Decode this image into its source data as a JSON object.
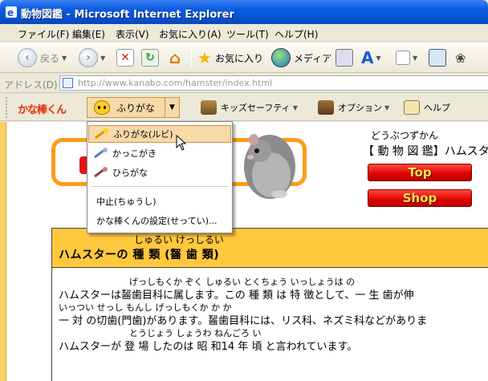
{
  "window": {
    "title": "動物図鑑 - Microsoft Internet Explorer"
  },
  "menubar": {
    "items": [
      {
        "label": "ファイル(F)"
      },
      {
        "label": "編集(E)"
      },
      {
        "label": "表示(V)"
      },
      {
        "label": "お気に入り(A)"
      },
      {
        "label": "ツール(T)"
      },
      {
        "label": "ヘルプ(H)"
      }
    ]
  },
  "toolbar": {
    "back_label": "戻る",
    "favorites_label": "お気に入り",
    "media_label": "メディア"
  },
  "address": {
    "label": "アドレス(D)",
    "url": "http://www.kanabo.com/hamster/index.html"
  },
  "kanabo": {
    "logo": "かな棒くん",
    "furigana_label": "ふりがな",
    "kids_safety_label": "キッズセーフティ",
    "option_label": "オプション",
    "help_label": "ヘルプ"
  },
  "dropdown": {
    "items": [
      {
        "label": "ふりがな(ルビ)"
      },
      {
        "label": "かっこがき"
      },
      {
        "label": "ひらがな"
      }
    ],
    "stop_label": "中止(ちゅうし)",
    "settings_label": "かな棒くんの設定(せってい)..."
  },
  "page": {
    "ruby_title": "どうぶつずかん",
    "db_title": "【 動 物 図 鑑】ハムスタ",
    "top_button": "Top",
    "shop_button": "Shop",
    "section_ruby": "しゅるい けっしるい",
    "section_title": "ハムスターの 種 類 (齧 歯 類)",
    "body": [
      {
        "ruby": "げっしもくか ぞく しゅるい とくちょう いっしょうは の",
        "text": "ハムスターは齧歯目科に属します。この 種 類 は 特 徴として、一 生 歯が伸"
      },
      {
        "ruby": "いっつい せっし もんし げっしもくか か か",
        "text": " 一 対 の切歯(門歯)があります。齧歯目科には、リス科、ネズミ科などがありま"
      },
      {
        "ruby": "とうじょう しょうわ ねんごろ い",
        "text": "ハムスターが 登 場 したのは 昭 和14 年 頃 と言われています。"
      }
    ]
  },
  "colors": {
    "accent_orange": "#ff9a1a",
    "section_yellow": "#ffc83d",
    "button_red": "#d00000",
    "button_text": "#ffe44a"
  }
}
